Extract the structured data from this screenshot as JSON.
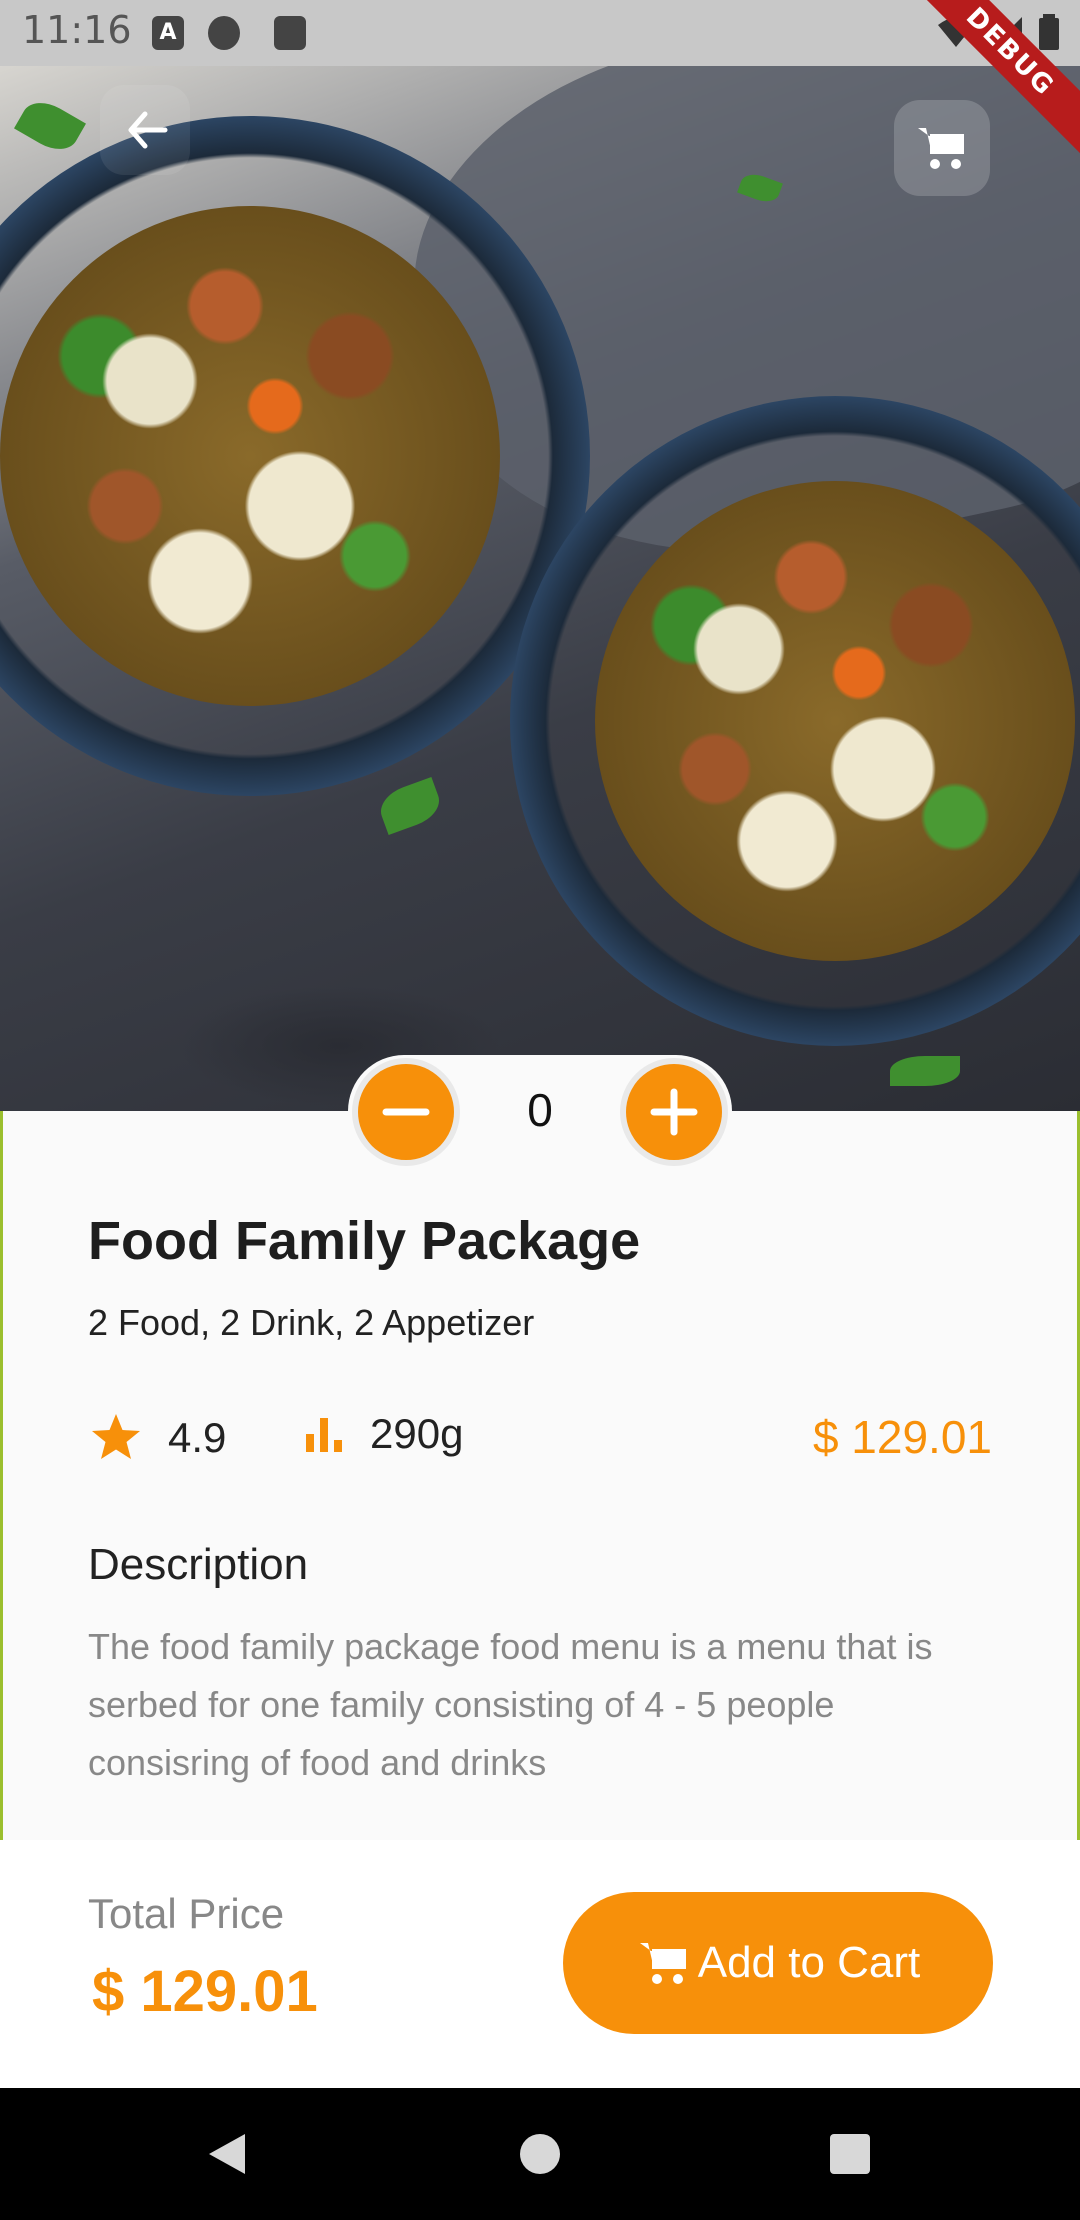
{
  "status_bar": {
    "time": "11:16",
    "icons": [
      "a-icon",
      "moon-icon",
      "sd-card-icon",
      "wifi-icon",
      "signal-icon",
      "battery-icon"
    ],
    "debug_label": "DEBUG"
  },
  "header": {
    "back_icon": "arrow-left-icon",
    "cart_icon": "cart-icon"
  },
  "quantity": {
    "value": "0",
    "minus_icon": "minus-icon",
    "plus_icon": "plus-icon"
  },
  "product": {
    "title": "Food Family Package",
    "subtitle": "2 Food, 2 Drink, 2 Appetizer",
    "rating": "4.9",
    "weight": "290g",
    "price": "$ 129.01"
  },
  "description": {
    "heading": "Description",
    "text": "The food family package food menu is a menu that is serbed for one family consisting of 4 - 5 people consisring of food and drinks"
  },
  "checkout": {
    "total_label": "Total Price",
    "total_price": "$ 129.01",
    "add_to_cart_label": "Add to Cart"
  },
  "colors": {
    "accent": "#f7900a",
    "background": "#fafafa",
    "title_text": "#1e1e1e",
    "muted_text": "#888888"
  }
}
